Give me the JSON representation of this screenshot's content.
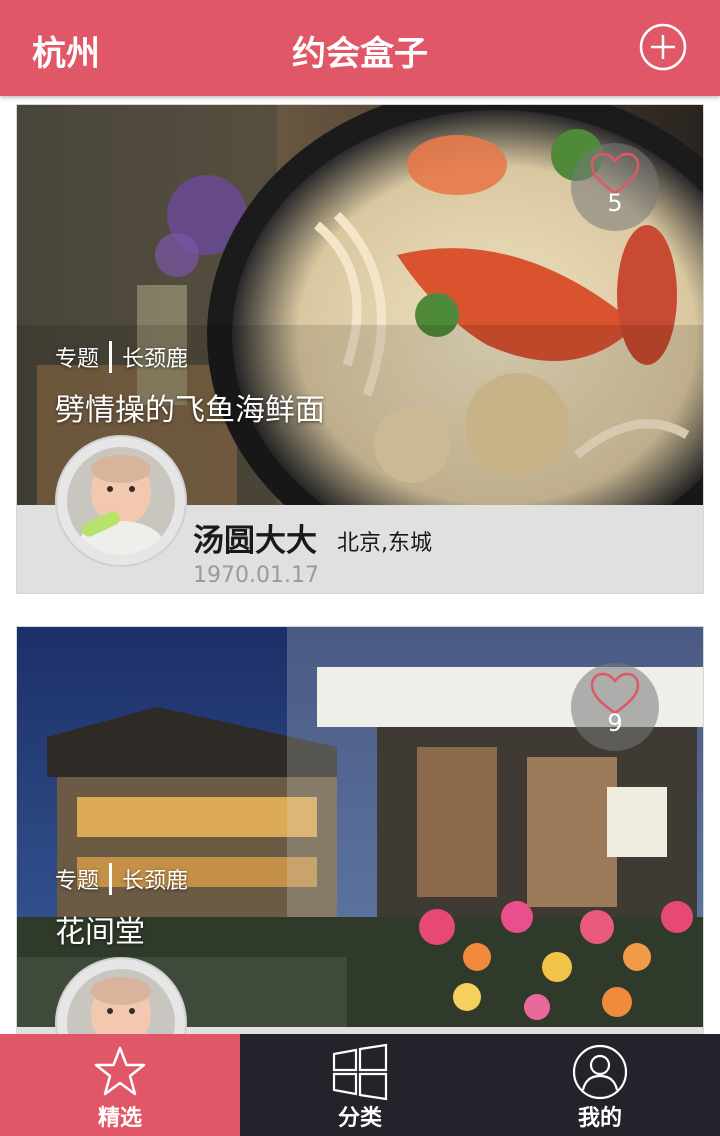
{
  "header": {
    "city": "杭州",
    "title": "约会盒子",
    "add_icon": "plus-circle-icon"
  },
  "colors": {
    "accent": "#e05767",
    "tabbar_bg": "#23232b",
    "card_bg": "#e0e0e0"
  },
  "feed": {
    "cards": [
      {
        "category": "专题",
        "subcategory": "长颈鹿",
        "title": "劈情操的飞鱼海鲜面",
        "likes": "5",
        "author": "汤圆大大",
        "location": "北京,东城",
        "date": "1970.01.17"
      },
      {
        "category": "专题",
        "subcategory": "长颈鹿",
        "title": "花间堂",
        "likes": "9"
      }
    ]
  },
  "tabbar": {
    "tabs": [
      {
        "label": "精选",
        "icon": "star-icon",
        "active": true
      },
      {
        "label": "分类",
        "icon": "windows-grid-icon",
        "active": false
      },
      {
        "label": "我的",
        "icon": "user-icon",
        "active": false
      }
    ]
  }
}
